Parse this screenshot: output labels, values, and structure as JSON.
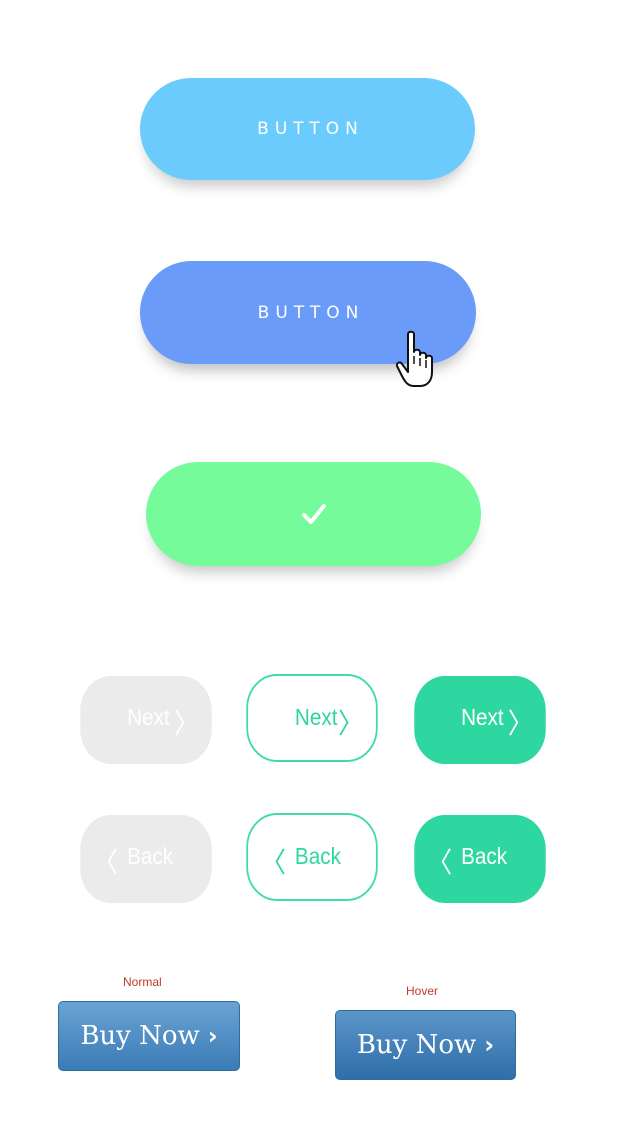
{
  "buttons": {
    "primary_label": "BUTTON",
    "hover_label": "BUTTON",
    "success_icon": "checkmark-icon"
  },
  "nav": {
    "next_label": "Next",
    "back_label": "Back",
    "next_icon": "chevron-right-icon",
    "back_icon": "chevron-left-icon",
    "variants": [
      "disabled",
      "outline",
      "filled"
    ]
  },
  "buy": {
    "normal_caption": "Normal",
    "hover_caption": "Hover",
    "label": "Buy Now"
  },
  "colors": {
    "light_blue": "#6bcbfd",
    "blue": "#6a9bf8",
    "green": "#76fb9a",
    "teal": "#2fd7a0",
    "disabled_grey": "#ebebeb",
    "buy_blue": "#3b7bb6",
    "caption_red": "#c0392b"
  }
}
